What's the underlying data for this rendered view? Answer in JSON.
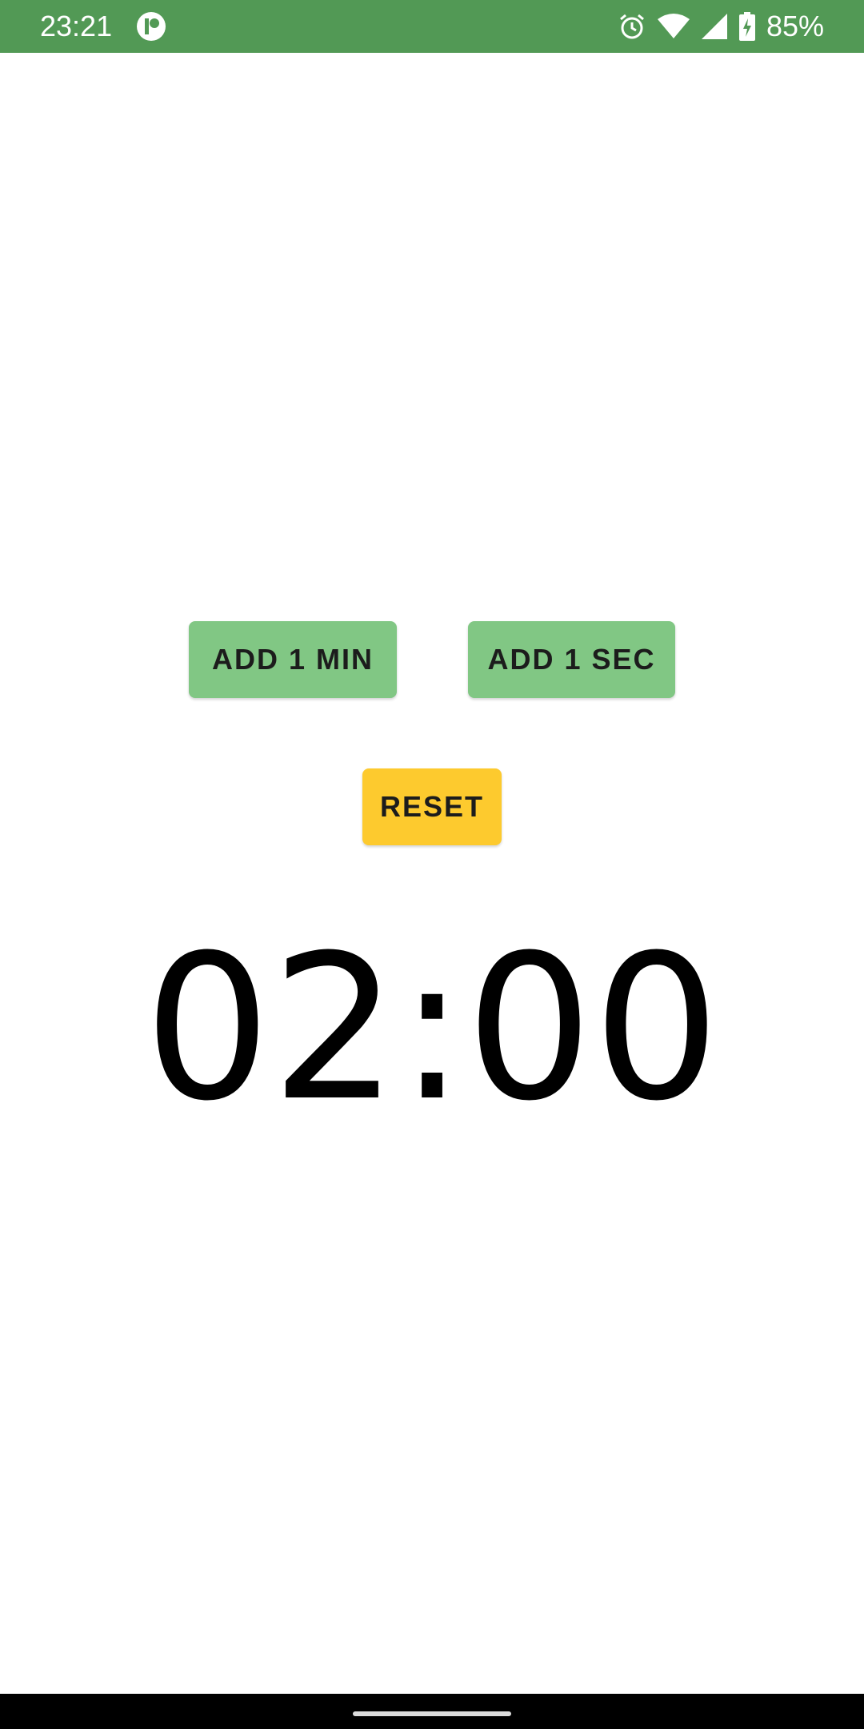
{
  "status_bar": {
    "time": "23:21",
    "battery": "85%",
    "icons": [
      "app-badge-icon",
      "alarm-icon",
      "wifi-icon",
      "signal-icon",
      "battery-charging-icon"
    ],
    "color": "#529955"
  },
  "controls": {
    "add_min_label": "ADD 1 MIN",
    "add_sec_label": "ADD 1 SEC",
    "reset_label": "RESET",
    "green": "#81c784",
    "yellow": "#fdca2e"
  },
  "timer": {
    "display": "02:00"
  },
  "nav_bar": {
    "icons": [
      "home-pill-icon"
    ]
  }
}
